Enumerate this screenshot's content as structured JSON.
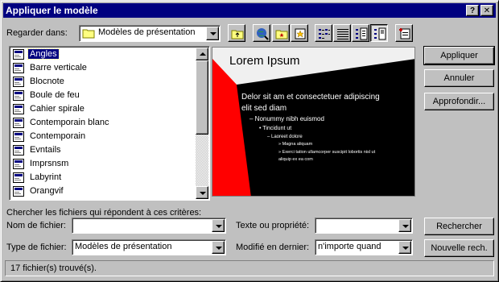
{
  "window": {
    "title": "Appliquer le modèle",
    "help_label": "?",
    "close_label": "✕"
  },
  "look_in": {
    "label": "Regarder dans:",
    "value": "Modèles de présentation"
  },
  "toolbar": {
    "icons": [
      "up-one-level-icon",
      "search-web-icon",
      "look-in-favorites-icon",
      "add-to-favorites-icon",
      "list-view-icon",
      "details-view-icon",
      "properties-view-icon",
      "preview-view-icon",
      "commands-settings-icon"
    ]
  },
  "files": [
    {
      "name": "Angles",
      "selected": true
    },
    {
      "name": "Barre verticale"
    },
    {
      "name": "Blocnote"
    },
    {
      "name": "Boule de feu"
    },
    {
      "name": "Cahier spirale"
    },
    {
      "name": "Contemporain blanc"
    },
    {
      "name": "Contemporain"
    },
    {
      "name": "Evntails"
    },
    {
      "name": "Imprsnsm"
    },
    {
      "name": "Labyrint"
    },
    {
      "name": "Orangvif"
    }
  ],
  "preview": {
    "title": "Lorem Ipsum",
    "bullets": [
      {
        "level": 1,
        "text": "Delor sit am et consectetuer adipiscing"
      },
      {
        "level": 1,
        "text": "elit sed diam"
      },
      {
        "level": 2,
        "text": "– Nonummy nibh euismod"
      },
      {
        "level": 3,
        "text": "• Tincidunt ut"
      },
      {
        "level": 4,
        "text": "– Laoreet dolore"
      },
      {
        "level": 5,
        "text": "» Magna aliquam"
      },
      {
        "level": 5,
        "text": "» Exerci tation ullamcorper suscipit lobortis nisl ut"
      },
      {
        "level": 5,
        "text": "aliquip ex ea com"
      }
    ],
    "colors": {
      "background": "#000000",
      "accent": "#ff0000",
      "title_band": "#f0f0f0"
    }
  },
  "buttons": {
    "apply": "Appliquer",
    "cancel": "Annuler",
    "advanced": "Approfondir...",
    "search": "Rechercher",
    "new_search": "Nouvelle rech."
  },
  "search": {
    "criteria_label": "Chercher les fichiers qui répondent à ces critères:",
    "file_name_label": "Nom de fichier:",
    "file_name_value": "",
    "file_type_label": "Type de fichier:",
    "file_type_value": "Modèles de présentation",
    "text_prop_label": "Texte ou propriété:",
    "text_prop_value": "",
    "modified_label": "Modifié en dernier:",
    "modified_value": "n'importe quand"
  },
  "status": {
    "text": "17 fichier(s) trouvé(s)."
  }
}
